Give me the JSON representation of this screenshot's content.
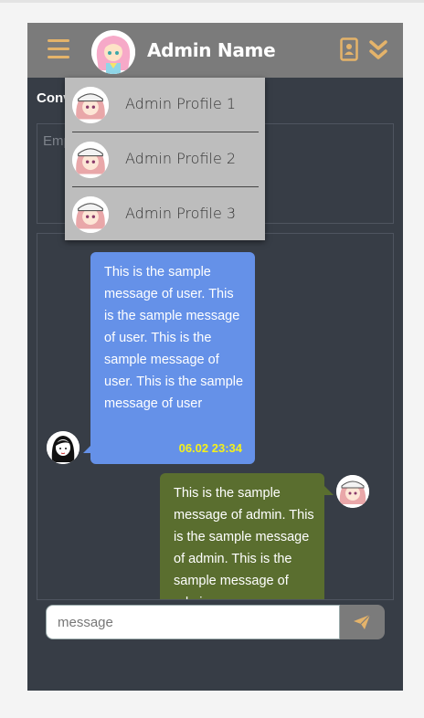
{
  "colors": {
    "header": "#7b7b7b",
    "app_bg": "#373d46",
    "accent": "#e4b36a",
    "user_bubble": "#6591e8",
    "admin_bubble": "#5a6e2f",
    "timestamp": "#f4f01c",
    "dropdown": "#bdbdbd"
  },
  "header": {
    "menu_icon": "hamburger-icon",
    "avatar_icon": "admin-avatar",
    "title": "Admin Name",
    "contact_icon": "contact-card-icon",
    "expand_icon": "double-chevron-down-icon"
  },
  "conversation": {
    "label": "Conv",
    "placeholder_text": "Emp"
  },
  "dropdown": {
    "items": [
      {
        "label": "Admin Profile 1"
      },
      {
        "label": "Admin Profile 2"
      },
      {
        "label": "Admin Profile 3"
      }
    ]
  },
  "messages": [
    {
      "sender": "user",
      "text": "This is the sample message of user. This is the sample message of user. This is the sample message of user. This is the sample message of user",
      "time": "06.02 23:34"
    },
    {
      "sender": "admin",
      "text": "This is the sample message of admin. This is the sample message of admin. This is the sample message of admin."
    }
  ],
  "composer": {
    "placeholder": "message",
    "send_icon": "paper-plane-icon"
  }
}
